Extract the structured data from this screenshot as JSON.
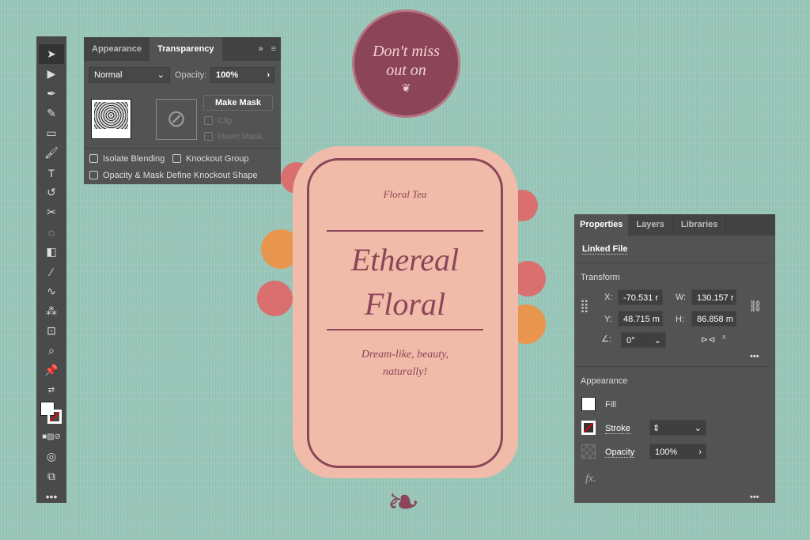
{
  "toolbar": {
    "more": "•••"
  },
  "transparency": {
    "tabs": [
      "Appearance",
      "Transparency"
    ],
    "overflow": "»",
    "blend_mode": "Normal",
    "opacity_label": "Opacity:",
    "opacity_value": "100%",
    "make_mask": "Make Mask",
    "clip": "Clip",
    "invert_mask": "Invert Mask",
    "isolate_blending": "Isolate Blending",
    "knockout_group": "Knockout Group",
    "knockout_shape": "Opacity & Mask Define Knockout Shape"
  },
  "properties": {
    "tabs": [
      "Properties",
      "Layers",
      "Libraries"
    ],
    "linked_file": "Linked File",
    "transform_title": "Transform",
    "x_label": "X:",
    "x_value": "-70.531 r",
    "y_label": "Y:",
    "y_value": "48.715 m",
    "w_label": "W:",
    "w_value": "130.157 r",
    "h_label": "H:",
    "h_value": "86.858 m",
    "angle_value": "0°",
    "more": "•••",
    "appearance_title": "Appearance",
    "fill": "Fill",
    "stroke": "Stroke",
    "opacity": "Opacity",
    "opacity_value": "100%",
    "fx": "fx."
  },
  "artwork": {
    "badge_line1": "Don't miss",
    "badge_line2": "out on",
    "label_top": "Floral Tea",
    "title1": "Ethereal",
    "title2": "Floral",
    "tagline1": "Dream-like, beauty,",
    "tagline2": "naturally!"
  },
  "colors": {
    "accent": "#8c4558",
    "label": "#f0bba8",
    "background": "#98c6b8"
  }
}
